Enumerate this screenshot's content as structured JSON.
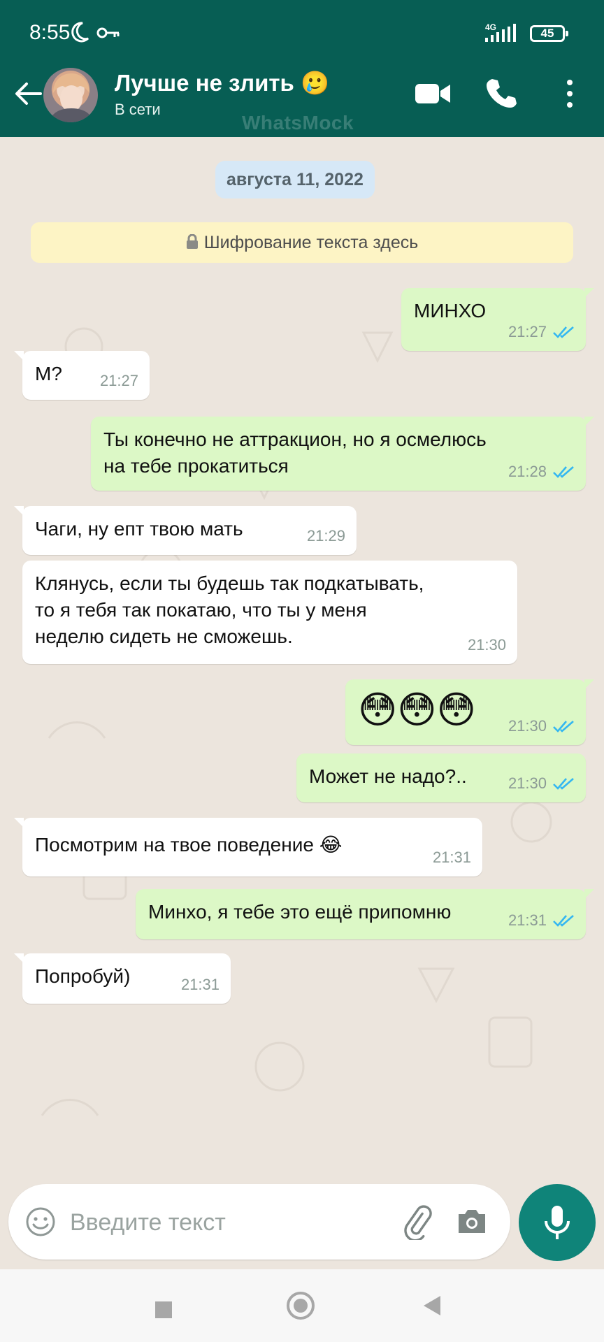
{
  "status_bar": {
    "time": "8:55",
    "network": "4G",
    "battery": "45"
  },
  "header": {
    "contact_name": "Лучше не злить 🥲",
    "contact_status": "В сети",
    "watermark": "WhatsMock"
  },
  "chat": {
    "date": "августа 11, 2022",
    "encryption_notice": "Шифрование текста здесь",
    "messages": [
      {
        "dir": "out",
        "text": "МИНХО",
        "time": "21:27"
      },
      {
        "dir": "in",
        "text": "М?",
        "time": "21:27"
      },
      {
        "dir": "out",
        "text": "Ты конечно не аттракцион, но я осмелюсь\nна тебе прокатиться",
        "time": "21:28"
      },
      {
        "dir": "in",
        "text": "Чаги, ну епт твою мать",
        "time": "21:29"
      },
      {
        "dir": "in",
        "text": "Клянусь, если ты будешь так подкатывать,\nто я тебя так покатаю, что ты у меня\nнеделю сидеть не сможешь.",
        "time": "21:30"
      },
      {
        "dir": "out",
        "text": "😳😳😳",
        "time": "21:30"
      },
      {
        "dir": "out",
        "text": "Может не надо?..",
        "time": "21:30"
      },
      {
        "dir": "in",
        "text": "Посмотрим на твое поведение 😂",
        "time": "21:31"
      },
      {
        "dir": "out",
        "text": "Минхо, я тебе это ещё припомню",
        "time": "21:31"
      },
      {
        "dir": "in",
        "text": "Попробуй)",
        "time": "21:31"
      }
    ]
  },
  "input": {
    "placeholder": "Введите текст"
  },
  "colors": {
    "header": "#075e54",
    "outgoing": "#dcf8c6",
    "incoming": "#ffffff",
    "ticks": "#34b7f1",
    "mic": "#0f8479"
  }
}
